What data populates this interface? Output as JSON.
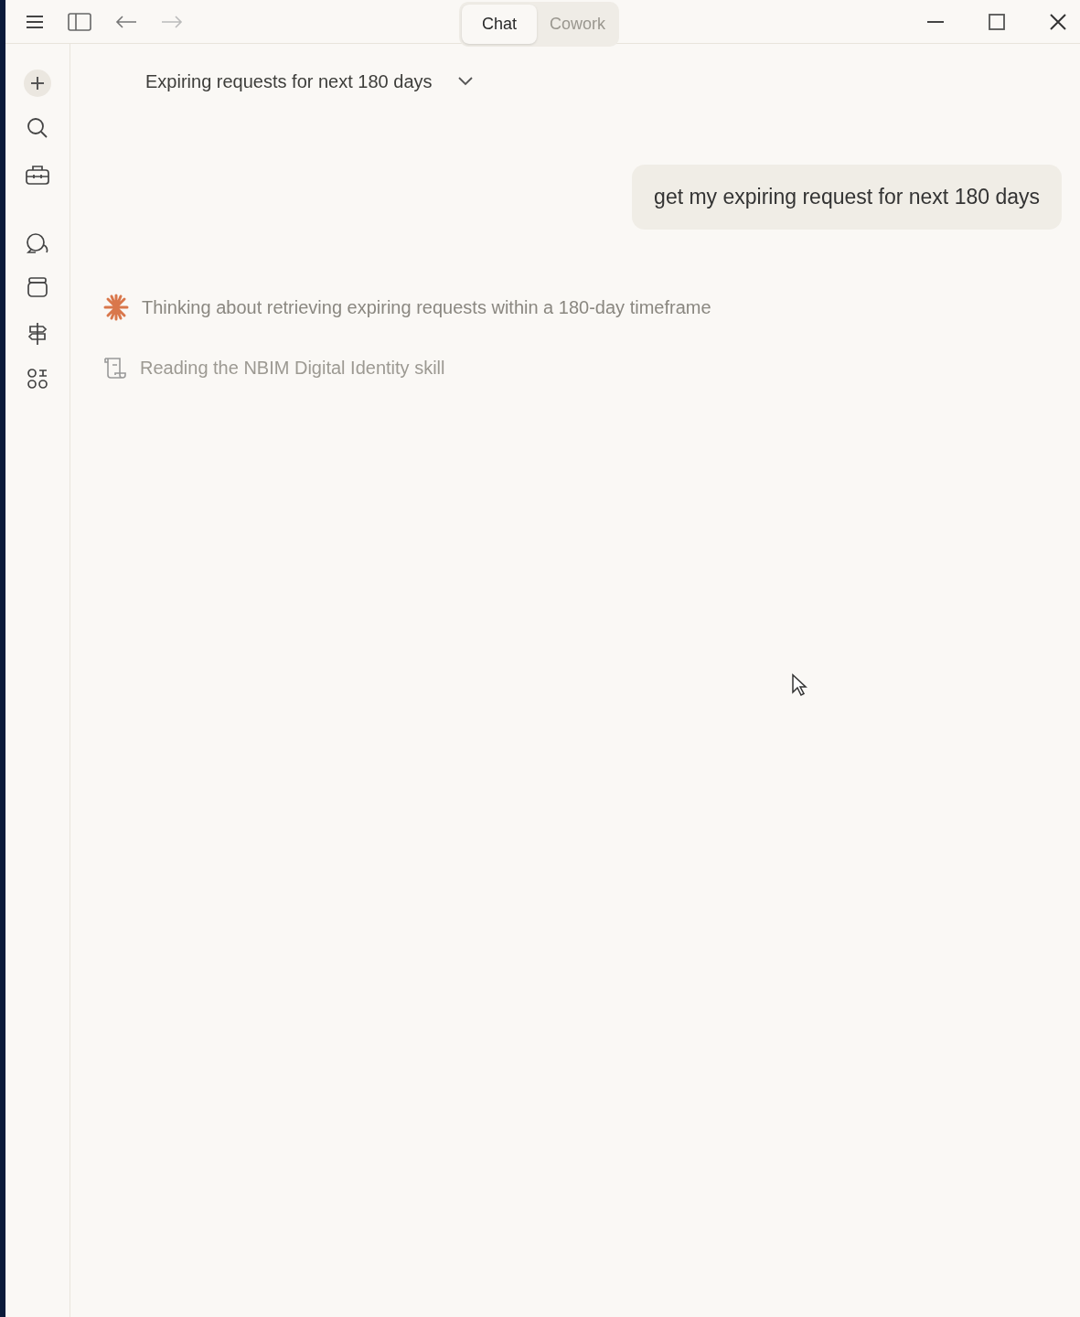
{
  "tabs": [
    {
      "label": "Chat",
      "selected": true
    },
    {
      "label": "Cowork",
      "selected": false
    }
  ],
  "conversation": {
    "title": "Expiring requests for next 180 days"
  },
  "messages": [
    {
      "text": "get my expiring request for next 180 days"
    }
  ],
  "activity": [
    {
      "kind": "thinking",
      "text": "Thinking about retrieving expiring requests within a 180-day timeframe"
    },
    {
      "kind": "reading",
      "text": "Reading the NBIM Digital Identity skill"
    }
  ]
}
